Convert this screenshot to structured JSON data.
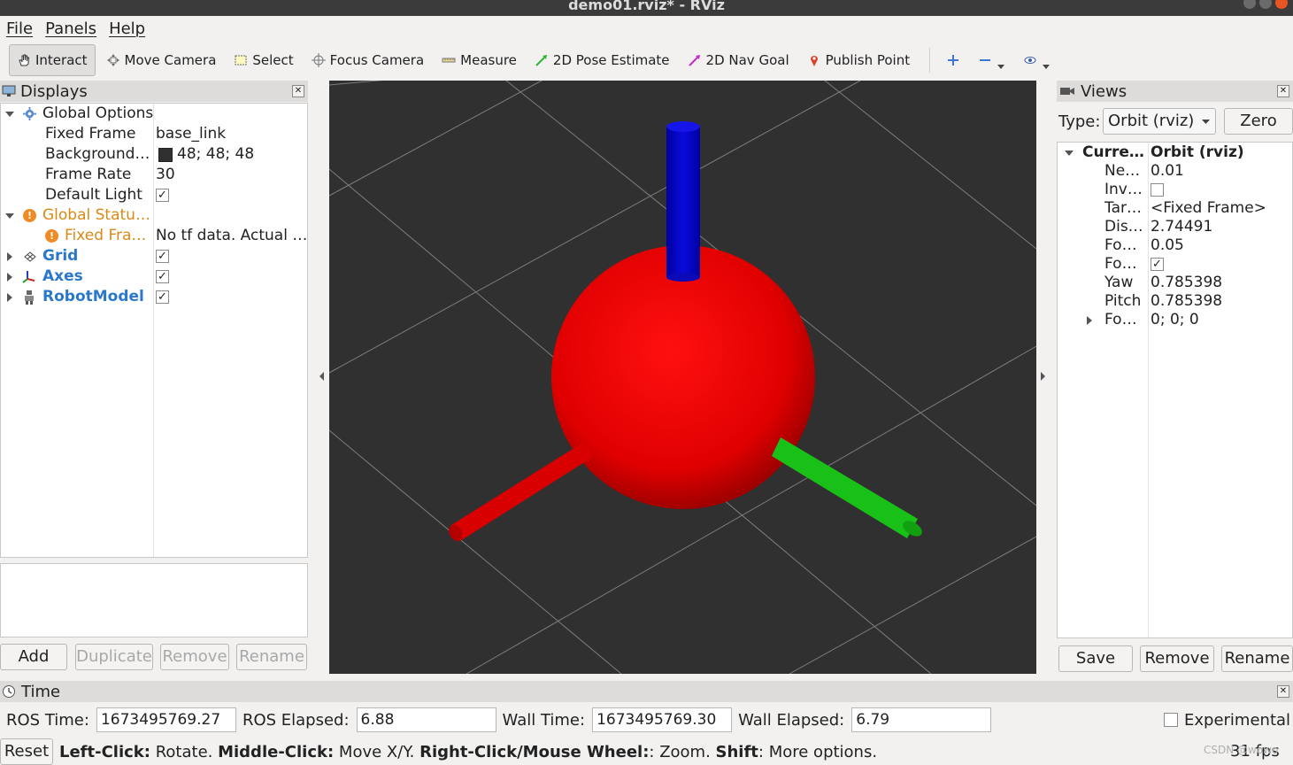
{
  "window": {
    "title": "demo01.rviz* - RViz"
  },
  "menu": [
    "File",
    "Panels",
    "Help"
  ],
  "toolbar": {
    "tools": [
      {
        "label": "Interact",
        "icon": "hand-icon",
        "active": true
      },
      {
        "label": "Move Camera",
        "icon": "move-camera-icon"
      },
      {
        "label": "Select",
        "icon": "select-box-icon"
      },
      {
        "label": "Focus Camera",
        "icon": "crosshair-icon"
      },
      {
        "label": "Measure",
        "icon": "ruler-icon"
      },
      {
        "label": "2D Pose Estimate",
        "icon": "green-arrow-icon"
      },
      {
        "label": "2D Nav Goal",
        "icon": "magenta-arrow-icon"
      },
      {
        "label": "Publish Point",
        "icon": "map-pin-icon"
      }
    ]
  },
  "displays": {
    "title": "Displays",
    "rows": {
      "global_options": "Global Options",
      "fixed_frame_label": "Fixed Frame",
      "fixed_frame_value": "base_link",
      "background_label": "Background…",
      "background_value": "48; 48; 48",
      "background_color": "#303030",
      "frame_rate_label": "Frame Rate",
      "frame_rate_value": "30",
      "default_light_label": "Default Light",
      "global_status_label": "Global Statu…",
      "fixed_frame_status_label": "Fixed Fra…",
      "fixed_frame_status_value": "No tf data.  Actual …",
      "grid_label": "Grid",
      "axes_label": "Axes",
      "robot_model_label": "RobotModel"
    },
    "buttons": {
      "add": "Add",
      "duplicate": "Duplicate",
      "remove": "Remove",
      "rename": "Rename"
    }
  },
  "views": {
    "title": "Views",
    "type_label": "Type:",
    "type_value": "Orbit (rviz)",
    "zero_button": "Zero",
    "rows": {
      "current_label": "Curre…",
      "current_value": "Orbit (rviz)",
      "near_label": "Ne…",
      "near_value": "0.01",
      "invert_label": "Inv…",
      "target_label": "Tar…",
      "target_value": "<Fixed Frame>",
      "distance_label": "Dis…",
      "distance_value": "2.74491",
      "focal_scale_label": "Fo…",
      "focal_scale_value": "0.05",
      "focal_shape_label": "Fo…",
      "yaw_label": "Yaw",
      "yaw_value": "0.785398",
      "pitch_label": "Pitch",
      "pitch_value": "0.785398",
      "focal_point_label": "Fo…",
      "focal_point_value": "0; 0; 0"
    },
    "buttons": {
      "save": "Save",
      "remove": "Remove",
      "rename": "Rename"
    }
  },
  "time": {
    "title": "Time",
    "ros_time_label": "ROS Time:",
    "ros_time_value": "1673495769.27",
    "ros_elapsed_label": "ROS Elapsed:",
    "ros_elapsed_value": "6.88",
    "wall_time_label": "Wall Time:",
    "wall_time_value": "1673495769.30",
    "wall_elapsed_label": "Wall Elapsed:",
    "wall_elapsed_value": "6.79",
    "experimental_label": "Experimental"
  },
  "status": {
    "reset": "Reset",
    "hint_b1": "Left-Click:",
    "hint_t1": " Rotate. ",
    "hint_b2": "Middle-Click:",
    "hint_t2": " Move X/Y. ",
    "hint_b3": "Right-Click/Mouse Wheel:",
    "hint_t3": ": Zoom. ",
    "hint_b4": "Shift",
    "hint_t4": ": More options.",
    "fps": "31 fps",
    "watermark": "CSDN @wowo"
  }
}
